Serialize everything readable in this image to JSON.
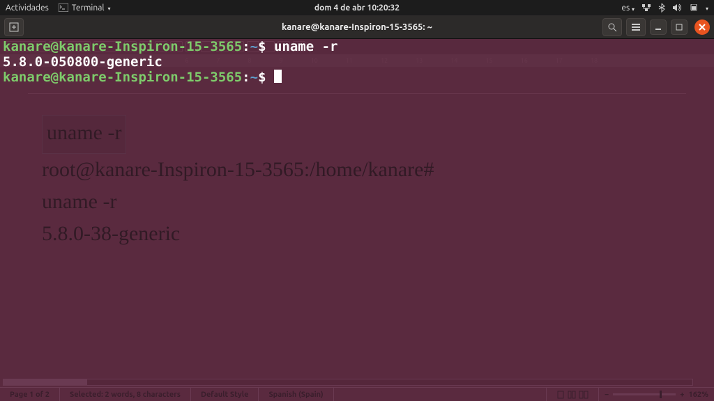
{
  "toppanel": {
    "activities": "Actividades",
    "app_name": "Terminal",
    "datetime": "dom  4 de abr  10:20:32",
    "lang": "es"
  },
  "titlebar": {
    "title": "kanare@kanare-Inspiron-15-3565: ~"
  },
  "terminal": {
    "l1_user": "kanare@kanare-Inspiron-15-3565",
    "l1_sep": ":",
    "l1_path": "~",
    "l1_dollar": "$ ",
    "l1_cmd": "uname -r",
    "l2_out": "5.8.0-050800-generic",
    "l3_user": "kanare@kanare-Inspiron-15-3565",
    "l3_sep": ":",
    "l3_path": "~",
    "l3_dollar": "$ "
  },
  "ghost_doc": {
    "ruler": [
      "1",
      "2",
      "3",
      "4",
      "5",
      "6",
      "7",
      "8",
      "9",
      "10",
      "11",
      "12",
      "13",
      "14",
      "15",
      "16",
      "17",
      "18"
    ],
    "line1": "uname -r",
    "line2": "root@kanare-Inspiron-15-3565:/home/kanare#",
    "line3": "uname -r",
    "line4": "5.8.0-38-generic"
  },
  "statusbar": {
    "page": "Page 1 of 2",
    "selection": "Selected: 2 words, 8 characters",
    "style": "Default Style",
    "lang": "Spanish (Spain)",
    "zoom": "162%"
  }
}
